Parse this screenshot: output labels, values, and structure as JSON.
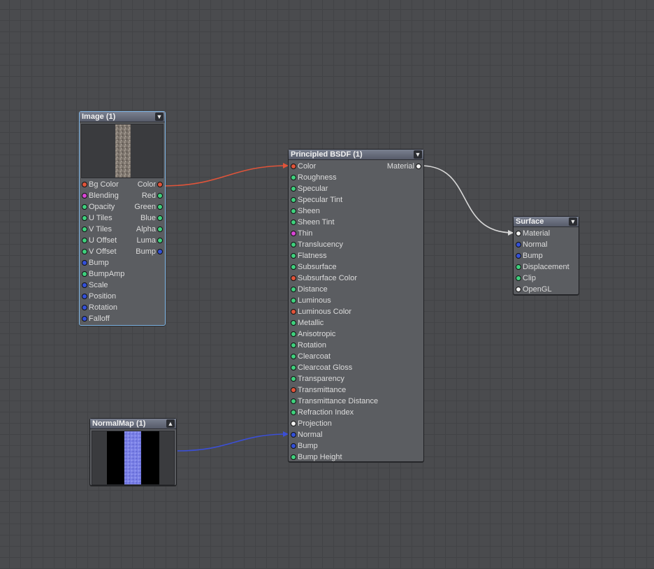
{
  "colors": {
    "red": "#e0543a",
    "green": "#3fd07d",
    "blue": "#3350d8",
    "magenta": "#d845d6",
    "white": "#f0f0f0",
    "wire_red": "#e0543a",
    "wire_blue": "#3b4fd6",
    "wire_white": "#d8d8d8"
  },
  "image_node": {
    "title": "Image (1)",
    "collapse_icon": "chevron-down-icon",
    "inputs": [
      {
        "label": "Bg Color",
        "color": "red"
      },
      {
        "label": "Blending",
        "color": "magenta"
      },
      {
        "label": "Opacity",
        "color": "green"
      },
      {
        "label": "U Tiles",
        "color": "green"
      },
      {
        "label": "V Tiles",
        "color": "green"
      },
      {
        "label": "U Offset",
        "color": "green"
      },
      {
        "label": "V Offset",
        "color": "green"
      },
      {
        "label": "Bump",
        "color": "blue"
      },
      {
        "label": "BumpAmp",
        "color": "green"
      },
      {
        "label": "Scale",
        "color": "blue"
      },
      {
        "label": "Position",
        "color": "blue"
      },
      {
        "label": "Rotation",
        "color": "blue"
      },
      {
        "label": "Falloff",
        "color": "blue"
      }
    ],
    "outputs": [
      {
        "label": "Color",
        "color": "red"
      },
      {
        "label": "Red",
        "color": "green"
      },
      {
        "label": "Green",
        "color": "green"
      },
      {
        "label": "Blue",
        "color": "green"
      },
      {
        "label": "Alpha",
        "color": "green"
      },
      {
        "label": "Luma",
        "color": "green"
      },
      {
        "label": "Bump",
        "color": "blue"
      }
    ]
  },
  "normalmap_node": {
    "title": "NormalMap (1)",
    "collapse_icon": "chevron-up-icon"
  },
  "bsdf_node": {
    "title": "Principled BSDF (1)",
    "collapse_icon": "chevron-down-icon",
    "inputs": [
      {
        "label": "Color",
        "color": "red"
      },
      {
        "label": "Roughness",
        "color": "green"
      },
      {
        "label": "Specular",
        "color": "green"
      },
      {
        "label": "Specular Tint",
        "color": "green"
      },
      {
        "label": "Sheen",
        "color": "green"
      },
      {
        "label": "Sheen Tint",
        "color": "green"
      },
      {
        "label": "Thin",
        "color": "magenta"
      },
      {
        "label": "Translucency",
        "color": "green"
      },
      {
        "label": "Flatness",
        "color": "green"
      },
      {
        "label": "Subsurface",
        "color": "green"
      },
      {
        "label": "Subsurface Color",
        "color": "red"
      },
      {
        "label": "Distance",
        "color": "green"
      },
      {
        "label": "Luminous",
        "color": "green"
      },
      {
        "label": "Luminous Color",
        "color": "red"
      },
      {
        "label": "Metallic",
        "color": "green"
      },
      {
        "label": "Anisotropic",
        "color": "green"
      },
      {
        "label": "Rotation",
        "color": "green"
      },
      {
        "label": "Clearcoat",
        "color": "green"
      },
      {
        "label": "Clearcoat Gloss",
        "color": "green"
      },
      {
        "label": "Transparency",
        "color": "green"
      },
      {
        "label": "Transmittance",
        "color": "red"
      },
      {
        "label": "Transmittance Distance",
        "color": "green"
      },
      {
        "label": "Refraction Index",
        "color": "green"
      },
      {
        "label": "Projection",
        "color": "white"
      },
      {
        "label": "Normal",
        "color": "blue"
      },
      {
        "label": "Bump",
        "color": "blue"
      },
      {
        "label": "Bump Height",
        "color": "green"
      }
    ],
    "outputs": [
      {
        "label": "Material",
        "color": "white"
      }
    ]
  },
  "surface_node": {
    "title": "Surface",
    "collapse_icon": "chevron-down-icon",
    "inputs": [
      {
        "label": "Material",
        "color": "white"
      },
      {
        "label": "Normal",
        "color": "blue"
      },
      {
        "label": "Bump",
        "color": "blue"
      },
      {
        "label": "Displacement",
        "color": "green"
      },
      {
        "label": "Clip",
        "color": "green"
      },
      {
        "label": "OpenGL",
        "color": "white"
      }
    ]
  }
}
